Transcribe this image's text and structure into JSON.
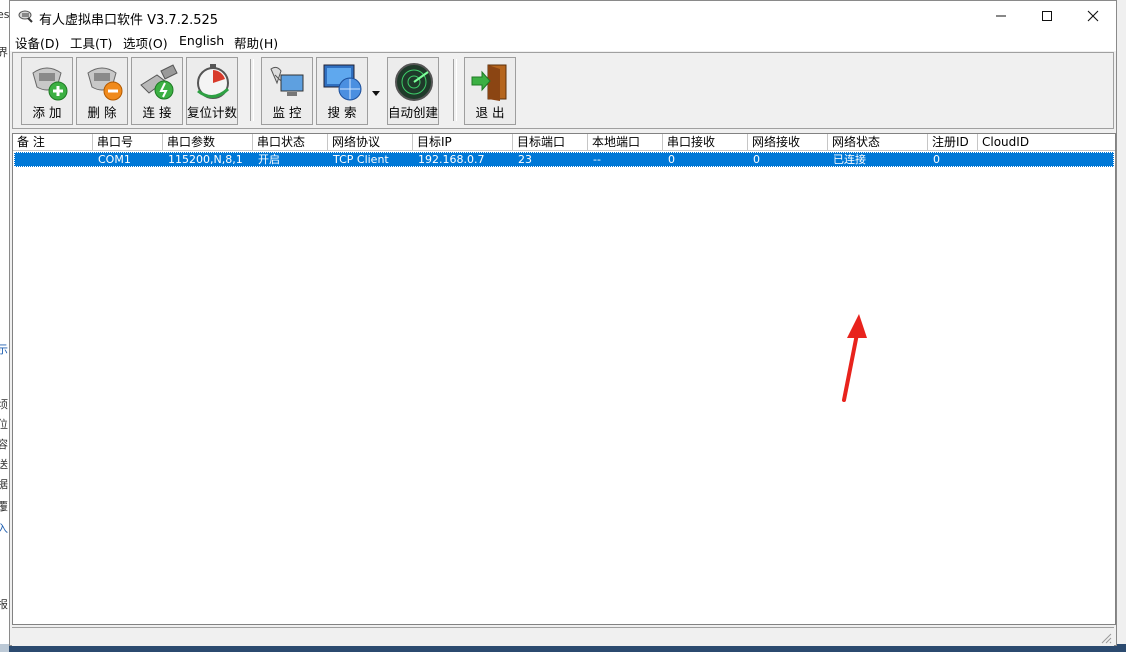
{
  "window": {
    "title": "有人虚拟串口软件 V3.7.2.525",
    "minimize_icon": "minimize-icon",
    "maximize_icon": "maximize-icon",
    "close_icon": "close-icon"
  },
  "menu": [
    {
      "label": "设备(D)"
    },
    {
      "label": "工具(T)"
    },
    {
      "label": "选项(O)"
    },
    {
      "label": "English"
    },
    {
      "label": "帮助(H)"
    }
  ],
  "toolbar": {
    "add": "添 加",
    "delete": "删 除",
    "connect": "连 接",
    "reset_count": "复位计数",
    "monitor": "监 控",
    "search": "搜 索",
    "auto_create": "自动创建",
    "exit": "退 出"
  },
  "table": {
    "columns": [
      "备 注",
      "串口号",
      "串口参数",
      "串口状态",
      "网络协议",
      "目标IP",
      "目标端口",
      "本地端口",
      "串口接收",
      "网络接收",
      "网络状态",
      "注册ID",
      "CloudID"
    ],
    "rows": [
      {
        "note": "",
        "port": "COM1",
        "params": "115200,N,8,1",
        "port_status": "开启",
        "protocol": "TCP Client",
        "target_ip": "192.168.0.7",
        "target_port": "23",
        "local_port": "--",
        "serial_rx": "0",
        "net_rx": "0",
        "net_status": "已连接",
        "reg_id": "0",
        "cloud_id": ""
      }
    ]
  },
  "colors": {
    "selection": "#0078d7",
    "annotation_arrow": "#e8231d"
  },
  "background_fragments": [
    "es",
    "界",
    "示",
    "顷",
    "位",
    "容",
    "送",
    "据",
    "覆",
    "入",
    "报"
  ]
}
